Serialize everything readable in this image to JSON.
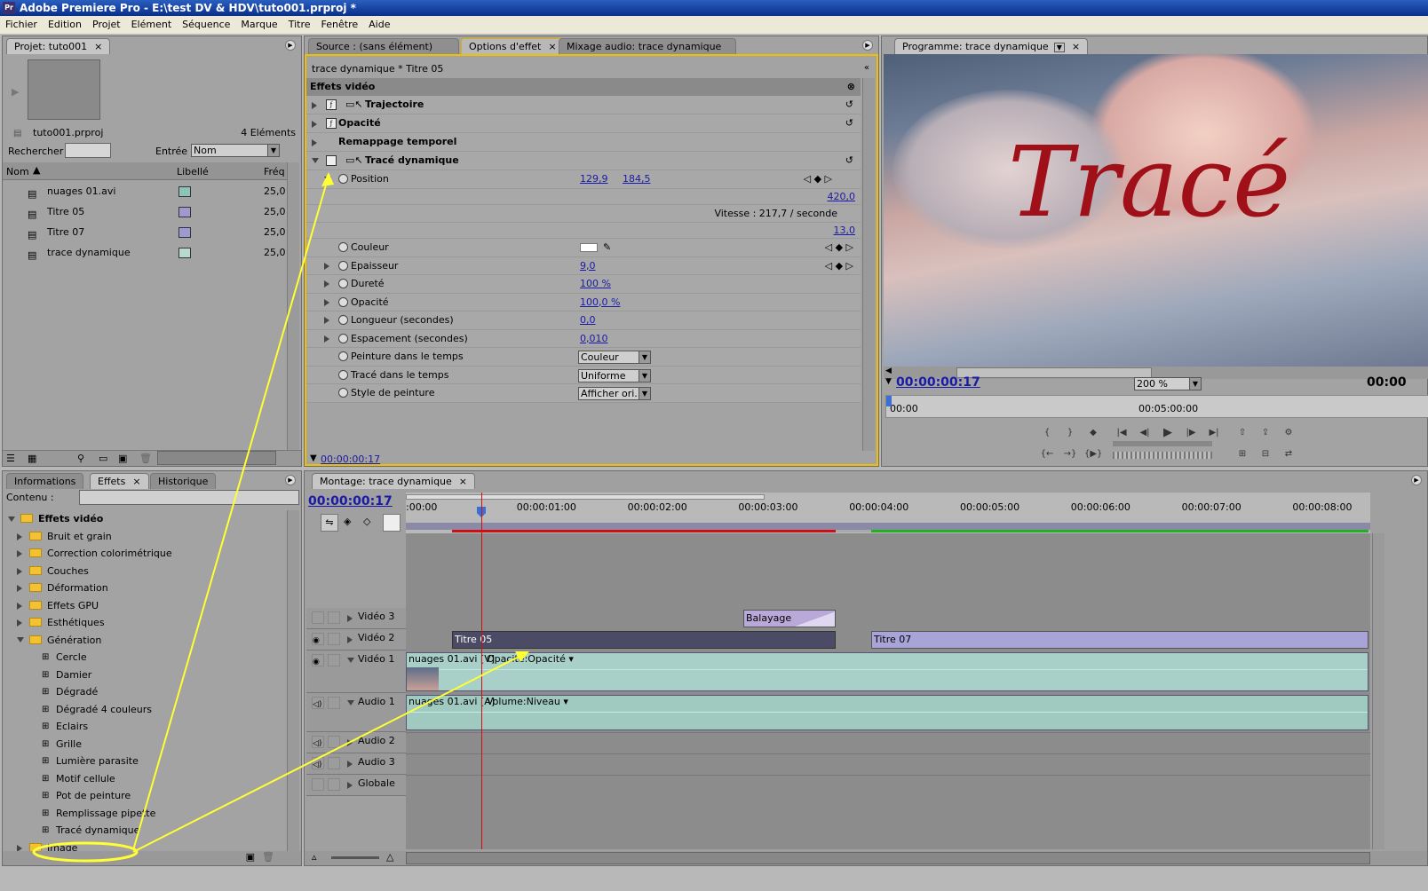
{
  "app": {
    "title": "Adobe Premiere Pro - E:\\test DV & HDV\\tuto001.prproj *",
    "icon": "Pr"
  },
  "menu": [
    "Fichier",
    "Edition",
    "Projet",
    "Elément",
    "Séquence",
    "Marque",
    "Titre",
    "Fenêtre",
    "Aide"
  ],
  "project": {
    "tab": "Projet: tuto001",
    "file": "tuto001.prproj",
    "count": "4 Eléments",
    "search_label": "Rechercher :",
    "entry_label": "Entrée :",
    "entry_value": "Nom",
    "columns": [
      "Nom",
      "Libellé",
      "Fréq"
    ],
    "items": [
      {
        "name": "nuages 01.avi",
        "fps": "25,0",
        "color": "#8fc3b6",
        "icon": "video-file-icon"
      },
      {
        "name": "Titre 05",
        "fps": "25,0",
        "color": "#9d9ad0",
        "icon": "title-file-icon"
      },
      {
        "name": "Titre 07",
        "fps": "25,0",
        "color": "#9d9ad0",
        "icon": "title-file-icon"
      },
      {
        "name": "trace dynamique",
        "fps": "25,0",
        "color": "#b8d8d0",
        "icon": "sequence-icon"
      }
    ]
  },
  "effect_options": {
    "tabs": [
      "Source : (sans élément)",
      "Options d'effet",
      "Mixage audio: trace dynamique"
    ],
    "clip": "trace dynamique * Titre 05",
    "section": "Effets vidéo",
    "effects": [
      "Trajectoire",
      "Opacité",
      "Remappage temporel",
      "Tracé dynamique"
    ],
    "position_label": "Position",
    "position_x": "129,9",
    "position_y": "184,5",
    "val_420": "420,0",
    "vitesse": "Vitesse : 217,7 / seconde",
    "val_13": "13,0",
    "params": [
      {
        "label": "Couleur",
        "value": ""
      },
      {
        "label": "Epaisseur",
        "value": "9,0"
      },
      {
        "label": "Dureté",
        "value": "100 %"
      },
      {
        "label": "Opacité",
        "value": "100,0 %"
      },
      {
        "label": "Longueur (secondes)",
        "value": "0,0"
      },
      {
        "label": "Espacement (secondes)",
        "value": "0,010"
      }
    ],
    "selects": [
      {
        "label": "Peinture dans le temps",
        "value": "Couleur"
      },
      {
        "label": "Tracé dans le temps",
        "value": "Uniforme"
      },
      {
        "label": "Style de peinture",
        "value": "Afficher ori..."
      }
    ],
    "timecode": "00:00:00:17"
  },
  "program": {
    "tab": "Programme: trace dynamique",
    "overlay_text": "Tracé",
    "timecode": "00:00:00:17",
    "zoom": "200 %",
    "end_time": "00:00",
    "ruler": [
      "00:00",
      "00:05:00:00"
    ]
  },
  "effects_panel": {
    "tabs": [
      "Informations",
      "Effets",
      "Historique"
    ],
    "content_label": "Contenu :",
    "root": "Effets vidéo",
    "folders": [
      "Bruit et grain",
      "Correction colorimétrique",
      "Couches",
      "Déformation",
      "Effets GPU",
      "Esthétiques",
      "Génération"
    ],
    "generation_items": [
      "Cercle",
      "Damier",
      "Dégradé",
      "Dégradé 4 couleurs",
      "Eclairs",
      "Grille",
      "Lumière parasite",
      "Motif cellule",
      "Pot de peinture",
      "Remplissage pipette",
      "Tracé dynamique"
    ],
    "next_folder": "Image"
  },
  "timeline": {
    "tab": "Montage: trace dynamique",
    "timecode": "00:00:00:17",
    "ruler": [
      ":00:00",
      "00:00:01:00",
      "00:00:02:00",
      "00:00:03:00",
      "00:00:04:00",
      "00:00:05:00",
      "00:00:06:00",
      "00:00:07:00",
      "00:00:08:00"
    ],
    "tracks": [
      "Vidéo 3",
      "Vidéo 2",
      "Vidéo 1",
      "Audio 1",
      "Audio 2",
      "Audio 3",
      "Globale"
    ],
    "clips": {
      "balayage": "Balayage",
      "titre05": "Titre 05",
      "titre07": "Titre 07",
      "video1": "nuages 01.avi [V]",
      "video1_fx": "Opacité:Opacité",
      "audio1": "nuages 01.avi [A]",
      "audio1_fx": "Volume:Niveau"
    }
  },
  "colors": {
    "highlight": "#f0d000",
    "annotation": "#ffff33",
    "playhead": "#d01010"
  }
}
